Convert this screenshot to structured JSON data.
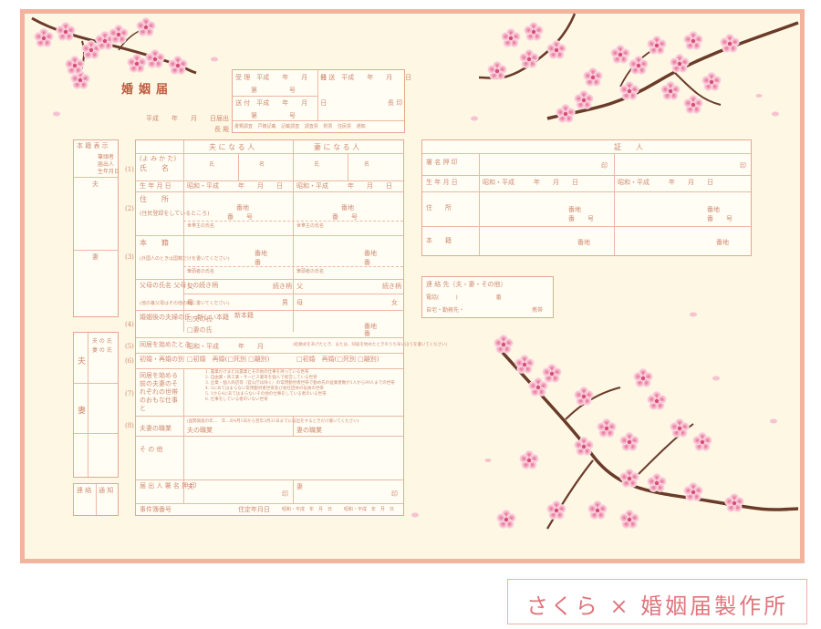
{
  "form": {
    "title": "婚姻届",
    "date_line": "平成　　年　　月　　日届出",
    "to_label": "長 殿",
    "receipt_table": {
      "received": "受 理　平成　　年　　月　　日",
      "number_a": "第　　　　　号",
      "sent": "発 送　平成　　年　　月　　日",
      "registered": "送 付　平成　　年　　月　　日",
      "number_b": "第　　　　　号",
      "chief": "長 印",
      "checks": [
        "書類調査",
        "戸籍記載",
        "記載調査",
        "調査票",
        "附票",
        "住民票",
        "通知"
      ]
    },
    "left_sidebar": {
      "top_label": "本 籍 表 示",
      "top_items": [
        "筆頭者",
        "届出人",
        "生年月日"
      ],
      "husband": "夫",
      "wife": "妻",
      "side_items": [
        "夫 の 氏",
        "妻 の 氏"
      ],
      "bottom_labels": [
        "連 絡",
        "通 知"
      ]
    },
    "columns": {
      "husband": "夫 に な る 人",
      "wife": "妻 に な る 人"
    },
    "rows": {
      "reading": "(よ み か た)",
      "name": "氏　　名",
      "family_name": "氏",
      "given_name": "名",
      "birth": "生 年 月 日",
      "birth_value_h": "昭和・平成　　　年　　月　　日",
      "birth_value_w": "昭和・平成　　　年　　月　　日",
      "address": "住　　所",
      "address_note": "(住民登録をしているところ)",
      "banchi": "番地",
      "go": "番　　号",
      "householder": "世帯主の氏名",
      "honseki": "本　　籍",
      "honseki_note": "(外国人のときは国籍だけを書いてください)",
      "ban": "番",
      "head": "筆頭者の氏名",
      "parents": "父母の氏名 父母との続き柄",
      "parents_note": "(他の養父母はその他の欄に書いてください)",
      "father": "父",
      "mother": "母",
      "relation": "続き柄",
      "son": "男",
      "daughter": "女",
      "new_name": "婚姻後の夫婦の氏・新しい本籍",
      "option_h": "□夫の氏",
      "option_w": "□妻の氏",
      "new_honseki": "新本籍",
      "cohab": "同居を始めたとき",
      "cohab_value": "昭和・平成　　　年　　月",
      "cohab_note": "(結婚式をあげたとき、または、同居を始めたときのうち早いほうを書いてください)",
      "first_marriage": "初婚・再婚の別",
      "first_marriage_h": "□初婚　再婚(□死別 □離別)",
      "first_marriage_w": "□初婚　再婚(□死別 □離別)",
      "work": "同居を始める前の夫妻のそれぞれの世帯のおもな仕事と",
      "work_items": [
        "1. 農業だけまたは農業とその他の仕事を持っている世帯",
        "2. 自由業・商工業・サービス業等を個人で経営している世帯",
        "3. 企業・個人商店等（官公庁は除く）の常用勤労者世帯で勤め先の従業者数が1人から99人までの世帯",
        "4. 3にあてはまらない常用勤労者世帯及び会社団体の役員の世帯",
        "5. 1から4にあてはまらないその他の仕事をしている者のいる世帯",
        "6. 仕事をしている者のいない世帯"
      ],
      "occupation": "夫妻の職業",
      "occupation_note": "(国勢調査の年…　年…の4月1日から翌年3月31日までに届出をするときだけ書いてください)",
      "occ_h": "夫の職業",
      "occ_w": "妻の職業",
      "other": "そ の 他",
      "signer": "届 出 人 署 名 押 印",
      "signer_h": "夫",
      "signer_w": "妻",
      "seal": "印",
      "case_no": "事件簿番号",
      "residence_date": "住定年月日",
      "residence_value_h": "昭和・平成　年　月　日",
      "residence_value_w": "昭和・平成　年　月　日"
    },
    "row_numbers": [
      "(1)",
      "(2)",
      "(3)",
      "(4)",
      "(5)",
      "(6)",
      "(7)",
      "(8)"
    ],
    "witness": {
      "header": "証　　人",
      "sign": "署 名 押 印",
      "seal": "印",
      "birth": "生 年 月 日",
      "birth_value": "昭和・平成　　　年　　月　　日",
      "address": "住　　所",
      "honseki": "本　　籍",
      "banchi": "番地",
      "go": "番　　号"
    },
    "contact": {
      "title": "連 絡 先（夫・妻・その他）",
      "phone": "電話(　　　)　　　　　　　番",
      "home": "自宅・勤務先・",
      "mobile": "携帯"
    }
  },
  "brand": {
    "text": "さくら × 婚姻届製作所"
  },
  "colors": {
    "background": "#fdf7e4",
    "frame": "#f2b49d",
    "lines": "#e5a890",
    "text": "#c98a70",
    "blossom": "#f5b5c9",
    "branch": "#6b3b2a",
    "brand_text": "#e0767d"
  }
}
